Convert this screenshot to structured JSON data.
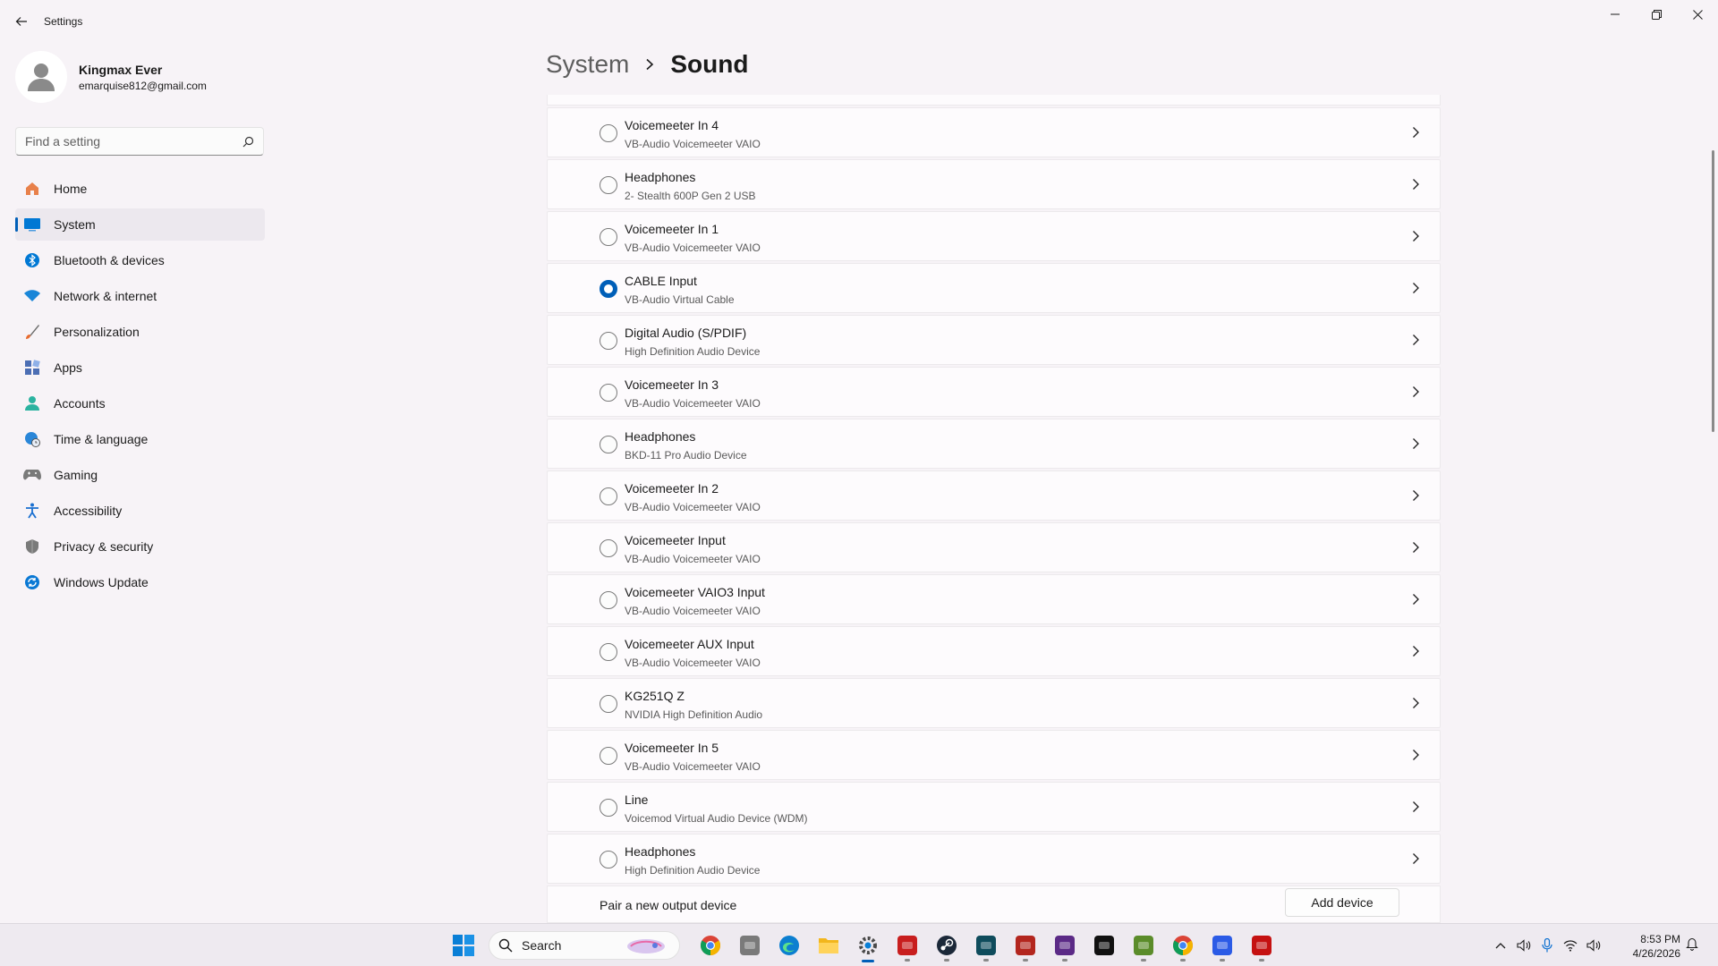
{
  "window": {
    "title": "Settings"
  },
  "profile": {
    "name": "Kingmax Ever",
    "email": "emarquise812@gmail.com"
  },
  "search": {
    "placeholder": "Find a setting"
  },
  "nav": [
    {
      "label": "Home",
      "icon": "home-icon",
      "color": "#e8804a"
    },
    {
      "label": "System",
      "icon": "system-icon",
      "color": "#0078d4",
      "active": true
    },
    {
      "label": "Bluetooth & devices",
      "icon": "bluetooth-icon",
      "color": "#0078d4"
    },
    {
      "label": "Network & internet",
      "icon": "wifi-icon",
      "color": "#1a86d8"
    },
    {
      "label": "Personalization",
      "icon": "brush-icon",
      "color": "#e86a2e"
    },
    {
      "label": "Apps",
      "icon": "apps-icon",
      "color": "#4c6eb4"
    },
    {
      "label": "Accounts",
      "icon": "accounts-icon",
      "color": "#2bb3a0"
    },
    {
      "label": "Time & language",
      "icon": "globe-clock-icon",
      "color": "#2a86d8"
    },
    {
      "label": "Gaming",
      "icon": "gamepad-icon",
      "color": "#7a7a7a"
    },
    {
      "label": "Accessibility",
      "icon": "accessibility-icon",
      "color": "#1a6fd0"
    },
    {
      "label": "Privacy & security",
      "icon": "shield-icon",
      "color": "#7a7a7a"
    },
    {
      "label": "Windows Update",
      "icon": "update-icon",
      "color": "#0a78d4"
    }
  ],
  "header": {
    "parent": "System",
    "current": "Sound"
  },
  "devices": [
    {
      "name": "Voicemeeter In 4",
      "sub": "VB-Audio Voicemeeter VAIO",
      "selected": false
    },
    {
      "name": "Headphones",
      "sub": "2- Stealth 600P Gen 2 USB",
      "selected": false
    },
    {
      "name": "Voicemeeter In 1",
      "sub": "VB-Audio Voicemeeter VAIO",
      "selected": false
    },
    {
      "name": "CABLE Input",
      "sub": "VB-Audio Virtual Cable",
      "selected": true
    },
    {
      "name": "Digital Audio (S/PDIF)",
      "sub": "High Definition Audio Device",
      "selected": false
    },
    {
      "name": "Voicemeeter In 3",
      "sub": "VB-Audio Voicemeeter VAIO",
      "selected": false
    },
    {
      "name": "Headphones",
      "sub": "BKD-11 Pro Audio Device",
      "selected": false
    },
    {
      "name": "Voicemeeter In 2",
      "sub": "VB-Audio Voicemeeter VAIO",
      "selected": false
    },
    {
      "name": "Voicemeeter Input",
      "sub": "VB-Audio Voicemeeter VAIO",
      "selected": false
    },
    {
      "name": "Voicemeeter VAIO3 Input",
      "sub": "VB-Audio Voicemeeter VAIO",
      "selected": false
    },
    {
      "name": "Voicemeeter AUX Input",
      "sub": "VB-Audio Voicemeeter VAIO",
      "selected": false
    },
    {
      "name": "KG251Q Z",
      "sub": "NVIDIA High Definition Audio",
      "selected": false
    },
    {
      "name": "Voicemeeter In 5",
      "sub": "VB-Audio Voicemeeter VAIO",
      "selected": false
    },
    {
      "name": "Line",
      "sub": "Voicemod Virtual Audio Device (WDM)",
      "selected": false
    },
    {
      "name": "Headphones",
      "sub": "High Definition Audio Device",
      "selected": false
    }
  ],
  "pair": {
    "label": "Pair a new output device",
    "button": "Add device"
  },
  "taskbar": {
    "search_label": "Search",
    "apps": [
      {
        "icon": "chrome-icon",
        "color": "#db4437",
        "state": ""
      },
      {
        "icon": "app-tile-icon",
        "color": "#7a7a7a",
        "state": ""
      },
      {
        "icon": "edge-icon",
        "color": "#0c7fd0",
        "state": ""
      },
      {
        "icon": "file-explorer-icon",
        "color": "#f2b61c",
        "state": ""
      },
      {
        "icon": "settings-icon",
        "color": "#4a4a4a",
        "state": "active"
      },
      {
        "icon": "recorder-icon",
        "color": "#c81e1e",
        "state": "running"
      },
      {
        "icon": "steam-icon",
        "color": "#1b2838",
        "state": "running"
      },
      {
        "icon": "monitor-app-icon",
        "color": "#0f4c5c",
        "state": "running"
      },
      {
        "icon": "voicemeeter-icon",
        "color": "#b3261e",
        "state": "running"
      },
      {
        "icon": "nzxt-icon",
        "color": "#5b2a86",
        "state": "running"
      },
      {
        "icon": "capcut-icon",
        "color": "#111111",
        "state": ""
      },
      {
        "icon": "minecraft-icon",
        "color": "#5b8c2a",
        "state": "running"
      },
      {
        "icon": "chrome-profile-icon",
        "color": "#db4437",
        "state": "running"
      },
      {
        "icon": "voicemod-icon",
        "color": "#2b5be6",
        "state": "running"
      },
      {
        "icon": "among-us-icon",
        "color": "#c51111",
        "state": "running"
      }
    ],
    "time": "8:53 PM",
    "date": "4/26/2026"
  }
}
